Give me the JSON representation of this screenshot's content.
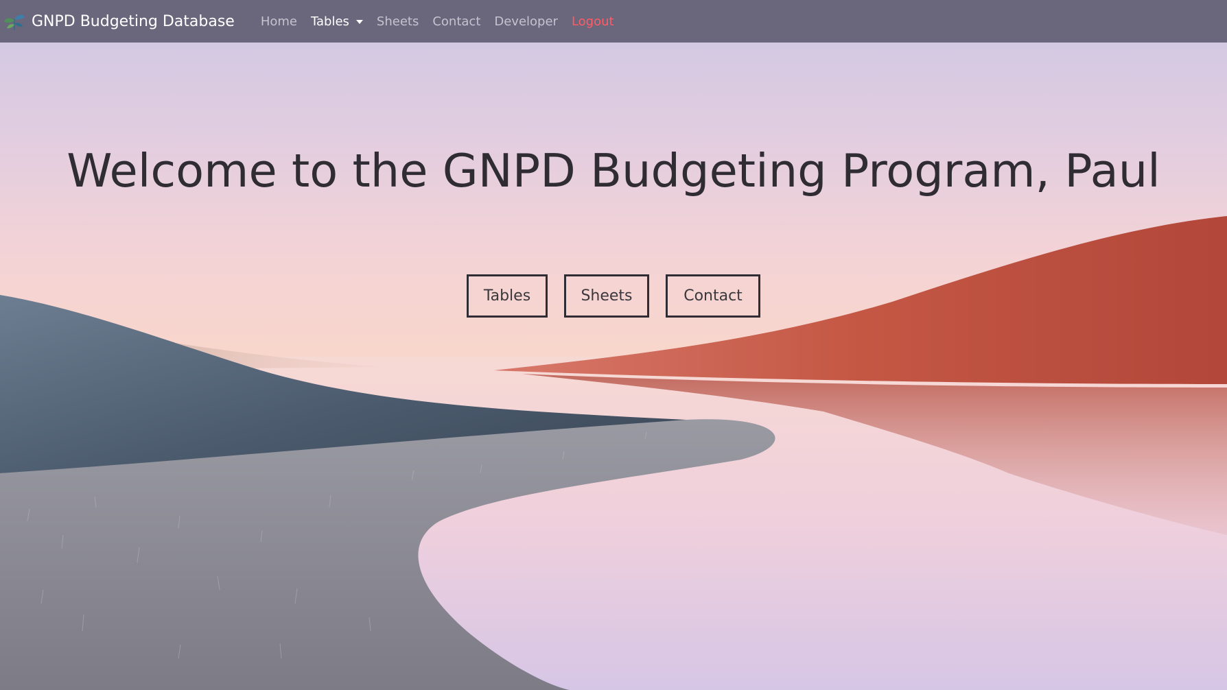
{
  "navbar": {
    "brand": "GNPD Budgeting Database",
    "logo_icon": "plant-logo-icon",
    "items": [
      {
        "label": "Home",
        "state": "inactive"
      },
      {
        "label": "Tables",
        "state": "active",
        "dropdown": true
      },
      {
        "label": "Sheets",
        "state": "inactive"
      },
      {
        "label": "Contact",
        "state": "inactive"
      },
      {
        "label": "Developer",
        "state": "inactive"
      },
      {
        "label": "Logout",
        "state": "logout"
      }
    ]
  },
  "hero": {
    "title": "Welcome to the GNPD Budgeting Program, Paul",
    "buttons": [
      {
        "label": "Tables"
      },
      {
        "label": "Sheets"
      },
      {
        "label": "Contact"
      }
    ]
  },
  "colors": {
    "navbar_bg": "#626074",
    "nav_inactive": "#c6c3d0",
    "nav_active": "#ffffff",
    "logout": "#ff5c66",
    "title_text": "#2f2d33"
  }
}
